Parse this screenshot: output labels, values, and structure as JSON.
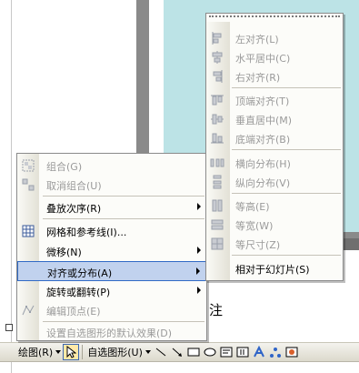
{
  "notes": {
    "text": "注"
  },
  "toolbar": {
    "draw_label": "绘图(R)",
    "select_label": "自选图形(U)"
  },
  "main_menu": {
    "items": [
      {
        "label": "组合(G)",
        "icon": "group-icon",
        "disabled": true
      },
      {
        "label": "取消组合(U)",
        "icon": "ungroup-icon",
        "disabled": true
      },
      {
        "label": "叠放次序(R)",
        "icon": "",
        "disabled": false,
        "submenu": true
      },
      {
        "label": "网格和参考线(I)...",
        "icon": "grid-icon",
        "disabled": false
      },
      {
        "label": "微移(N)",
        "icon": "",
        "disabled": false,
        "submenu": true
      },
      {
        "label": "对齐或分布(A)",
        "icon": "",
        "disabled": false,
        "submenu": true,
        "highlighted": true
      },
      {
        "label": "旋转或翻转(P)",
        "icon": "",
        "disabled": false,
        "submenu": true
      },
      {
        "label": "编辑顶点(E)",
        "icon": "edit-points-icon",
        "disabled": true
      },
      {
        "label": "设置自选图形的默认效果(D)",
        "icon": "",
        "disabled": true
      }
    ]
  },
  "align_submenu": {
    "items": [
      {
        "label": "左对齐(L)",
        "icon": "align-left-icon",
        "disabled": true
      },
      {
        "label": "水平居中(C)",
        "icon": "align-center-icon",
        "disabled": true
      },
      {
        "label": "右对齐(R)",
        "icon": "align-right-icon",
        "disabled": true
      },
      {
        "label": "顶端对齐(T)",
        "icon": "align-top-icon",
        "disabled": true
      },
      {
        "label": "垂直居中(M)",
        "icon": "align-middle-icon",
        "disabled": true
      },
      {
        "label": "底端对齐(B)",
        "icon": "align-bottom-icon",
        "disabled": true
      },
      {
        "label": "横向分布(H)",
        "icon": "distribute-horizontal-icon",
        "disabled": true
      },
      {
        "label": "纵向分布(V)",
        "icon": "distribute-vertical-icon",
        "disabled": true
      },
      {
        "label": "等高(E)",
        "icon": "same-height-icon",
        "disabled": true
      },
      {
        "label": "等宽(W)",
        "icon": "same-width-icon",
        "disabled": true
      },
      {
        "label": "等尺寸(Z)",
        "icon": "same-size-icon",
        "disabled": true
      },
      {
        "label": "相对于幻灯片(S)",
        "icon": "",
        "disabled": false
      }
    ]
  },
  "colors": {
    "highlight": "#c1d2ee",
    "highlight_border": "#316ac5",
    "slide": "#bce3e6",
    "disabled_text": "#9a9a9a"
  }
}
